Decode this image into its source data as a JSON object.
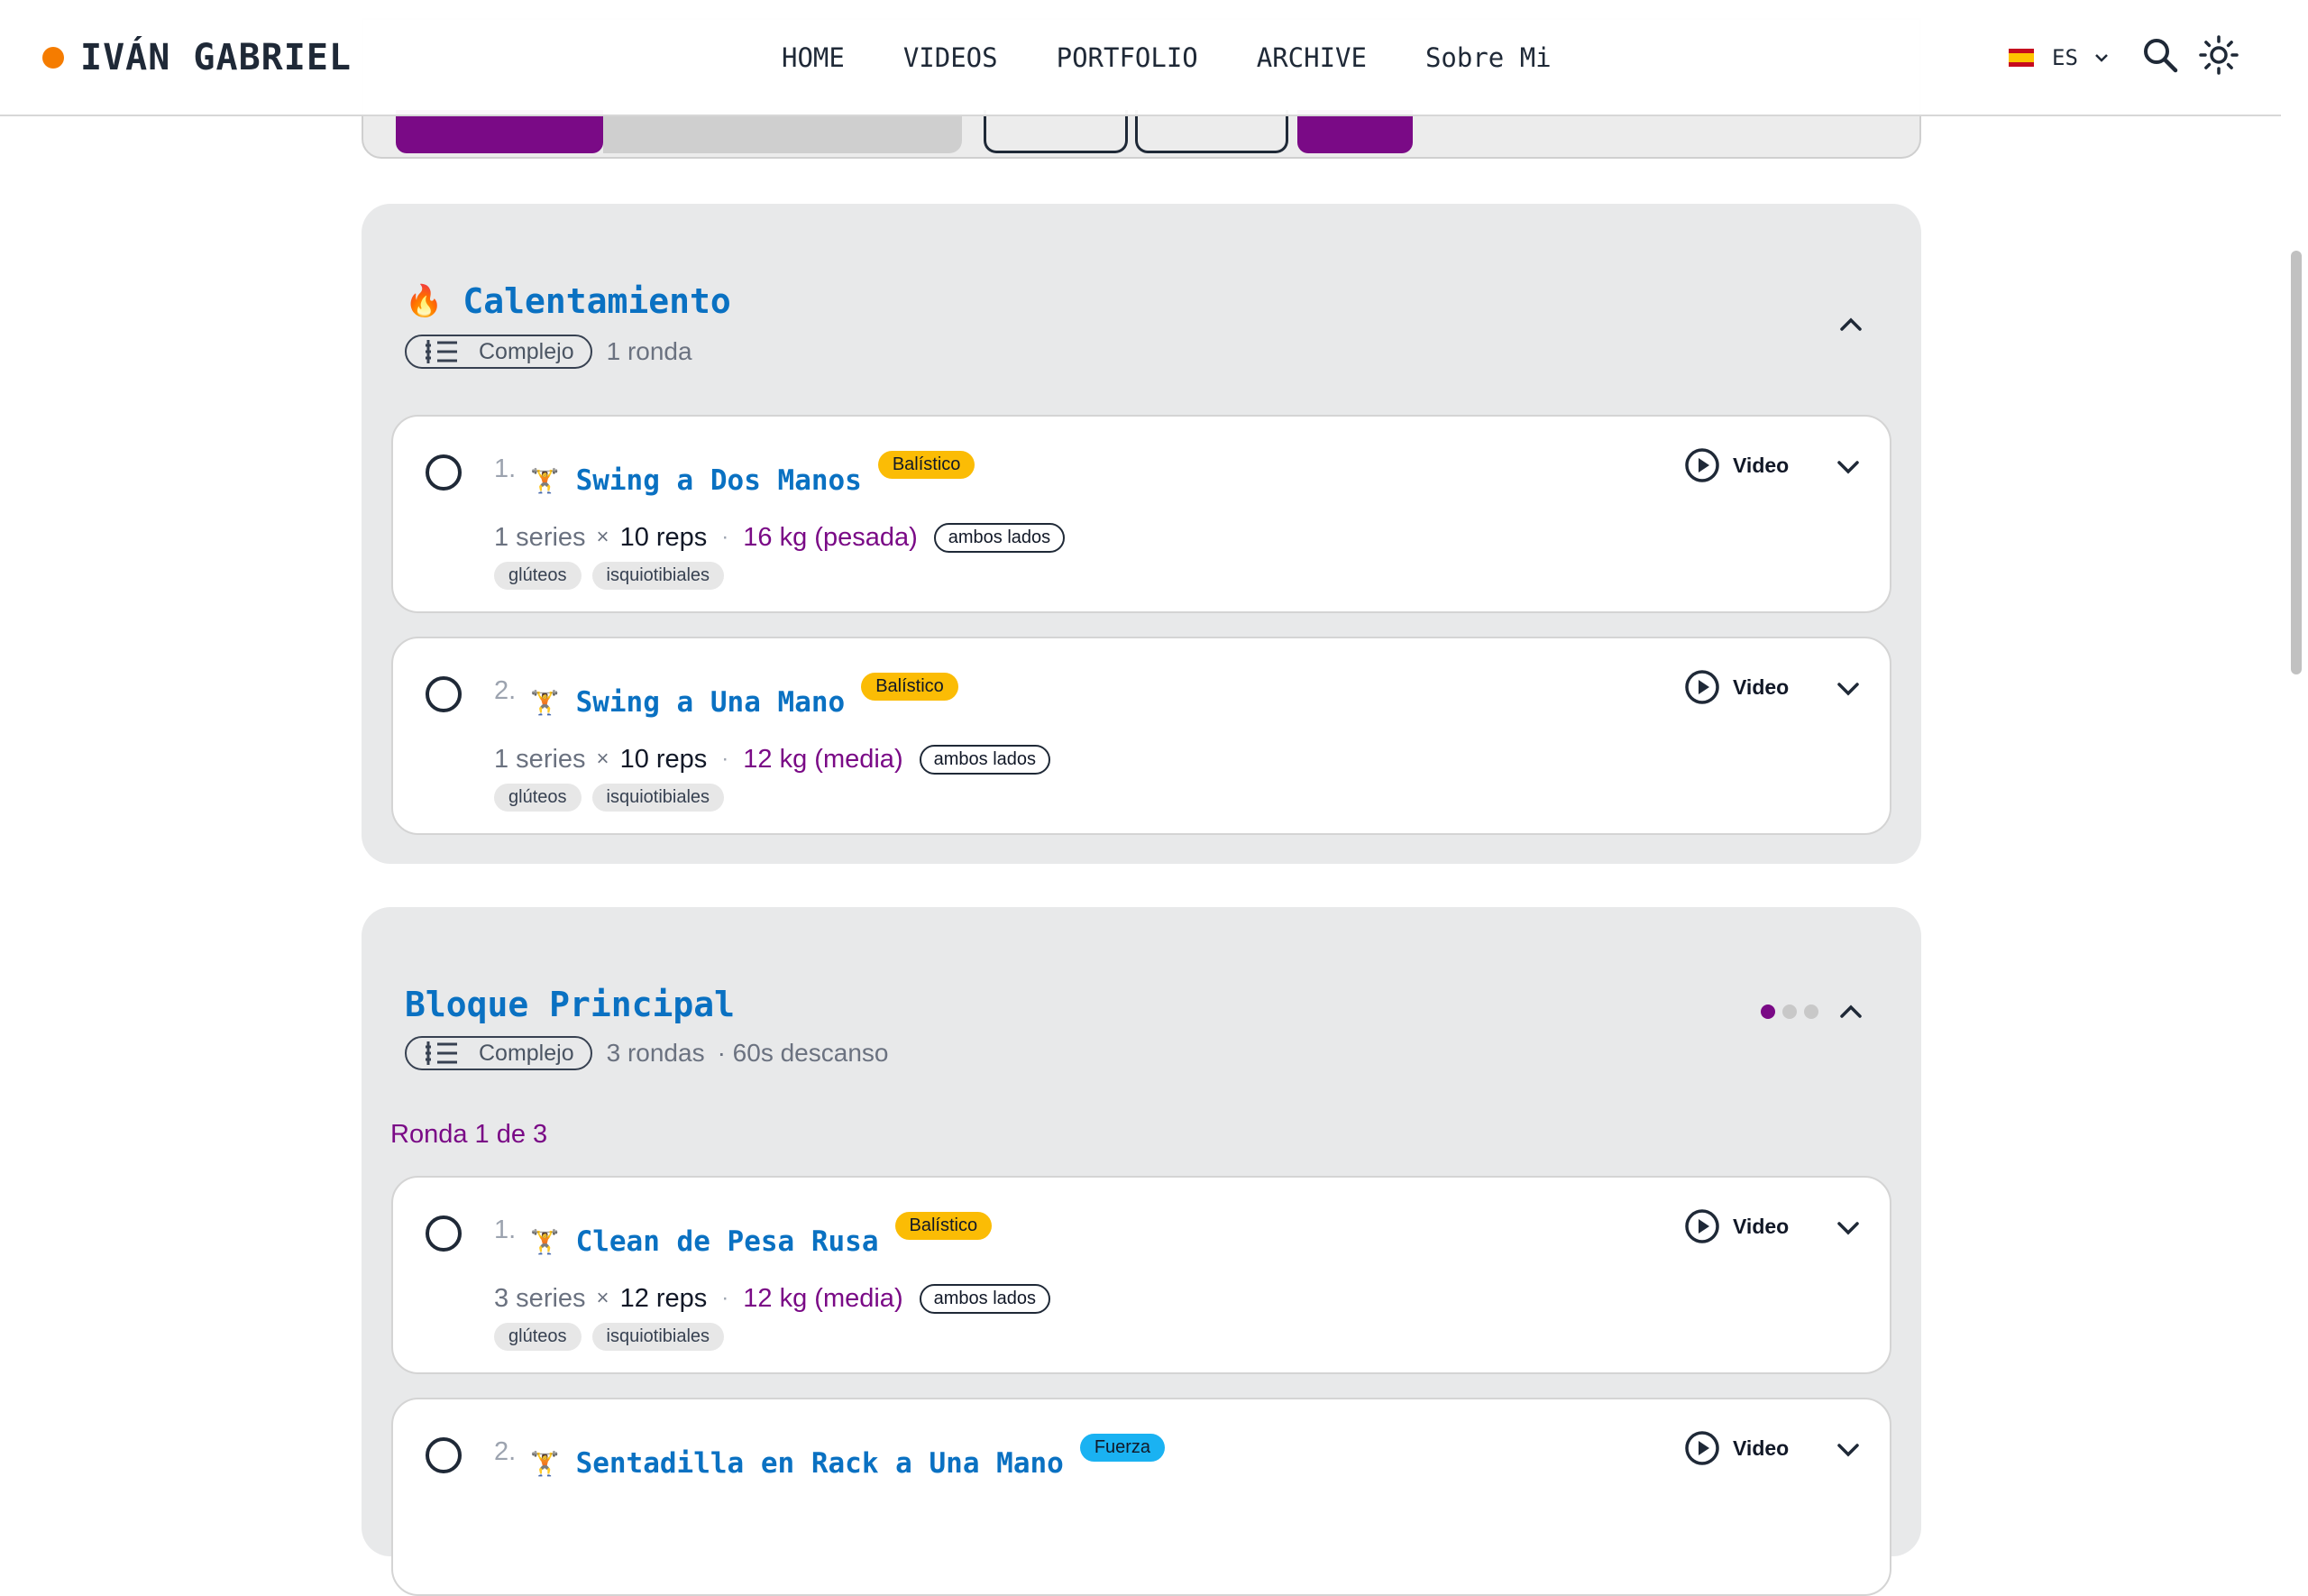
{
  "header": {
    "brand": "IVÁN GABRIEL",
    "brand_dot_color": "#f57c00",
    "nav": [
      "HOME",
      "VIDEOS",
      "PORTFOLIO",
      "ARCHIVE",
      "Sobre Mi"
    ],
    "language": {
      "flag_icon": "spain-flag-icon",
      "code": "ES"
    },
    "icons": [
      "search-icon",
      "sun-icon"
    ]
  },
  "colors": {
    "title_blue": "#0a71c2",
    "accent_purple": "#7a0a86",
    "tag_balistico": "#fbbc05",
    "tag_fuerza": "#1ab2f2"
  },
  "blocks": [
    {
      "emoji": "🔥",
      "title": "Calentamiento",
      "type": "Complejo",
      "rounds": "1 ronda",
      "exercises": [
        {
          "num": "1.",
          "name": "Swing a Dos Manos",
          "tag": "Balístico",
          "video": "Video",
          "series": "1 series",
          "times": "×",
          "reps": "10 reps",
          "sep": "·",
          "weight": "16 kg (pesada)",
          "sides": "ambos lados",
          "muscles": [
            "glúteos",
            "isquiotibiales"
          ]
        },
        {
          "num": "2.",
          "name": "Swing a Una Mano",
          "tag": "Balístico",
          "video": "Video",
          "series": "1 series",
          "times": "×",
          "reps": "10 reps",
          "sep": "·",
          "weight": "12 kg (media)",
          "sides": "ambos lados",
          "muscles": [
            "glúteos",
            "isquiotibiales"
          ]
        }
      ]
    },
    {
      "title": "Bloque Principal",
      "type": "Complejo",
      "rounds": "3 rondas",
      "rest": "· 60s descanso",
      "round_label": "Ronda 1 de 3",
      "progress_dots": {
        "total": 3,
        "current": 1
      },
      "exercises": [
        {
          "num": "1.",
          "name": "Clean de Pesa Rusa",
          "tag": "Balístico",
          "video": "Video",
          "series": "3 series",
          "times": "×",
          "reps": "12 reps",
          "sep": "·",
          "weight": "12 kg (media)",
          "sides": "ambos lados",
          "muscles": [
            "glúteos",
            "isquiotibiales"
          ]
        },
        {
          "num": "2.",
          "name": "Sentadilla en Rack a Una Mano",
          "tag": "Fuerza",
          "video": "Video"
        }
      ]
    }
  ]
}
